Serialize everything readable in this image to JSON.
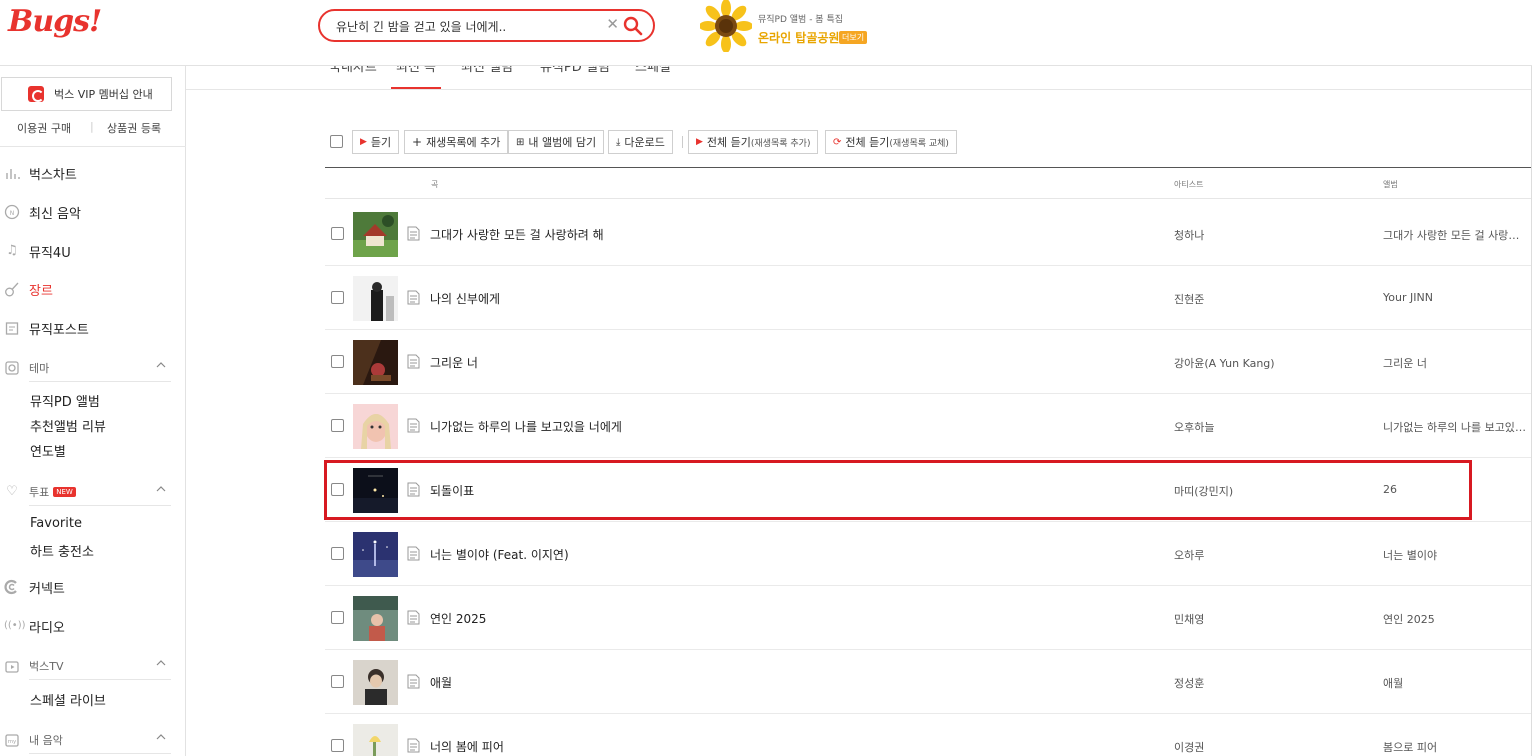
{
  "header": {
    "logo": "Bugs!",
    "search": {
      "value": "유난히 긴 밤을 걷고 있을 너에게..",
      "placeholder": ""
    },
    "promo": {
      "sub": "뮤직PD 앨범 - 봄 특집",
      "main": "온라인 탑골공원",
      "more": "더보기"
    }
  },
  "sidebar": {
    "vip": "벅스 VIP 멤버십 안내",
    "sublinks": [
      "이용권 구매",
      "상품권 등록"
    ],
    "nav": [
      {
        "label": "벅스차트",
        "icon": "chart-icon"
      },
      {
        "label": "최신 음악",
        "icon": "new-music-icon"
      },
      {
        "label": "뮤직4U",
        "icon": "music-note-icon"
      },
      {
        "label": "장르",
        "icon": "guitar-icon"
      },
      {
        "label": "뮤직포스트",
        "icon": "post-icon"
      }
    ],
    "theme": {
      "label": "테마",
      "items": [
        "뮤직PD 앨범",
        "추천앨범 리뷰",
        "연도별"
      ]
    },
    "vote": {
      "label": "투표",
      "badge": "NEW",
      "items": [
        "Favorite",
        "하트 충전소"
      ]
    },
    "connect": "커넥트",
    "radio": "라디오",
    "bugstv": {
      "label": "벅스TV",
      "items": [
        "스페셜 라이브"
      ]
    },
    "mymusic": {
      "label": "내 음악"
    }
  },
  "tabs": [
    "국내차트",
    "최신 곡",
    "최신 앨범",
    "뮤직PD 앨범",
    "스페셜"
  ],
  "toolbar": {
    "listen": "듣기",
    "add_playlist": "재생목록에 추가",
    "add_album": "내 앨범에 담기",
    "download": "다운로드",
    "play_all_add": "전체 듣기",
    "play_all_add_small": "(재생목록 추가)",
    "play_all_replace": "전체 듣기",
    "play_all_replace_small": "(재생목록 교체)"
  },
  "table": {
    "headers": {
      "song": "곡",
      "artist": "아티스트",
      "album": "앨범"
    },
    "rows": [
      {
        "title": "그대가 사랑한 모든 걸 사랑하려 해",
        "artist": "청하나",
        "album": "그대가 사랑한 모든 걸 사랑하려 해"
      },
      {
        "title": "나의 신부에게",
        "artist": "진현준",
        "album": "Your JINN"
      },
      {
        "title": "그리운 너",
        "artist": "강아윤(A Yun Kang)",
        "album": "그리운 너"
      },
      {
        "title": "니가없는 하루의 나를 보고있을 너에게",
        "artist": "오후하늘",
        "album": "니가없는 하루의 나를 보고있을 너에게"
      },
      {
        "title": "되돌이표",
        "artist": "마띠(강민지)",
        "album": "26"
      },
      {
        "title": "너는 별이야 (Feat. 이지연)",
        "artist": "오하루",
        "album": "너는 별이야"
      },
      {
        "title": "연인 2025",
        "artist": "민채영",
        "album": "연인 2025"
      },
      {
        "title": "애월",
        "artist": "정성훈",
        "album": "애월"
      },
      {
        "title": "너의 봄에 피어",
        "artist": "이경권",
        "album": "봄으로 피어"
      }
    ]
  },
  "colors": {
    "accent": "#e8332e",
    "highlight": "#d71921"
  }
}
